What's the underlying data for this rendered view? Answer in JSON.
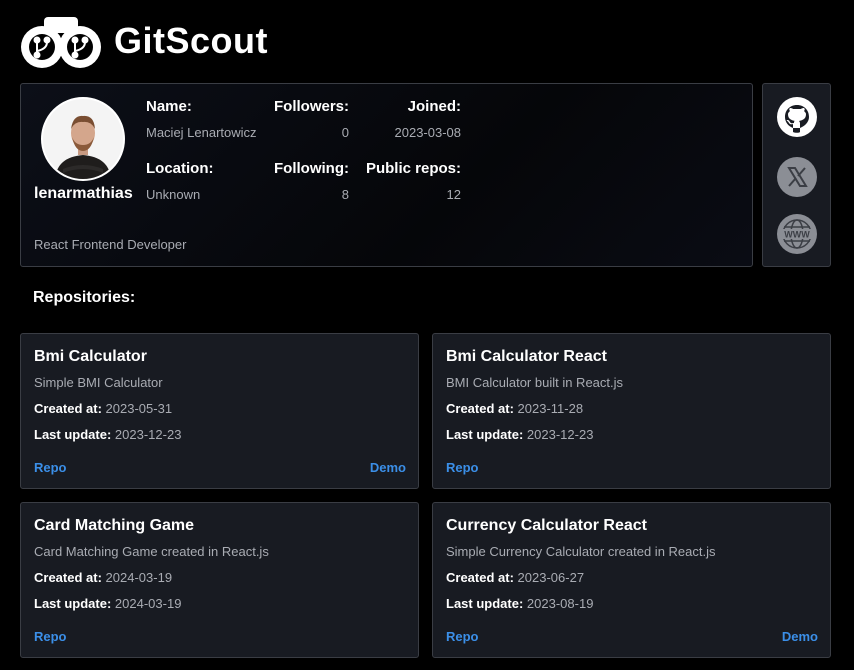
{
  "app": {
    "title": "GitScout"
  },
  "profile": {
    "username": "lenarmathias",
    "bio": "React Frontend Developer",
    "name_label": "Name:",
    "name": "Maciej Lenartowicz",
    "followers_label": "Followers:",
    "followers": "0",
    "joined_label": "Joined:",
    "joined": "2023-03-08",
    "location_label": "Location:",
    "location": "Unknown",
    "following_label": "Following:",
    "following": "8",
    "public_repos_label": "Public repos:",
    "public_repos": "12"
  },
  "social": {
    "icons": [
      "github-icon",
      "x-icon",
      "www-icon"
    ]
  },
  "repositories": {
    "heading": "Repositories:",
    "created_label": "Created at:",
    "updated_label": "Last update:",
    "repo_link_label": "Repo",
    "demo_link_label": "Demo",
    "items": [
      {
        "name": "Bmi Calculator",
        "description": "Simple BMI Calculator",
        "created": "2023-05-31",
        "updated": "2023-12-23",
        "has_demo": true
      },
      {
        "name": "Bmi Calculator React",
        "description": "BMI Calculator built in React.js",
        "created": "2023-11-28",
        "updated": "2023-12-23",
        "has_demo": false
      },
      {
        "name": "Card Matching Game",
        "description": "Card Matching Game created in React.js",
        "created": "2024-03-19",
        "updated": "2024-03-19",
        "has_demo": false
      },
      {
        "name": "Currency Calculator React",
        "description": "Simple Currency Calculator created in React.js",
        "created": "2023-06-27",
        "updated": "2023-08-19",
        "has_demo": true
      }
    ]
  },
  "colors": {
    "background": "#000000",
    "card": "#181b22",
    "border": "#3a3d44",
    "link": "#3b8fe8",
    "muted_text": "#a9acb3"
  }
}
